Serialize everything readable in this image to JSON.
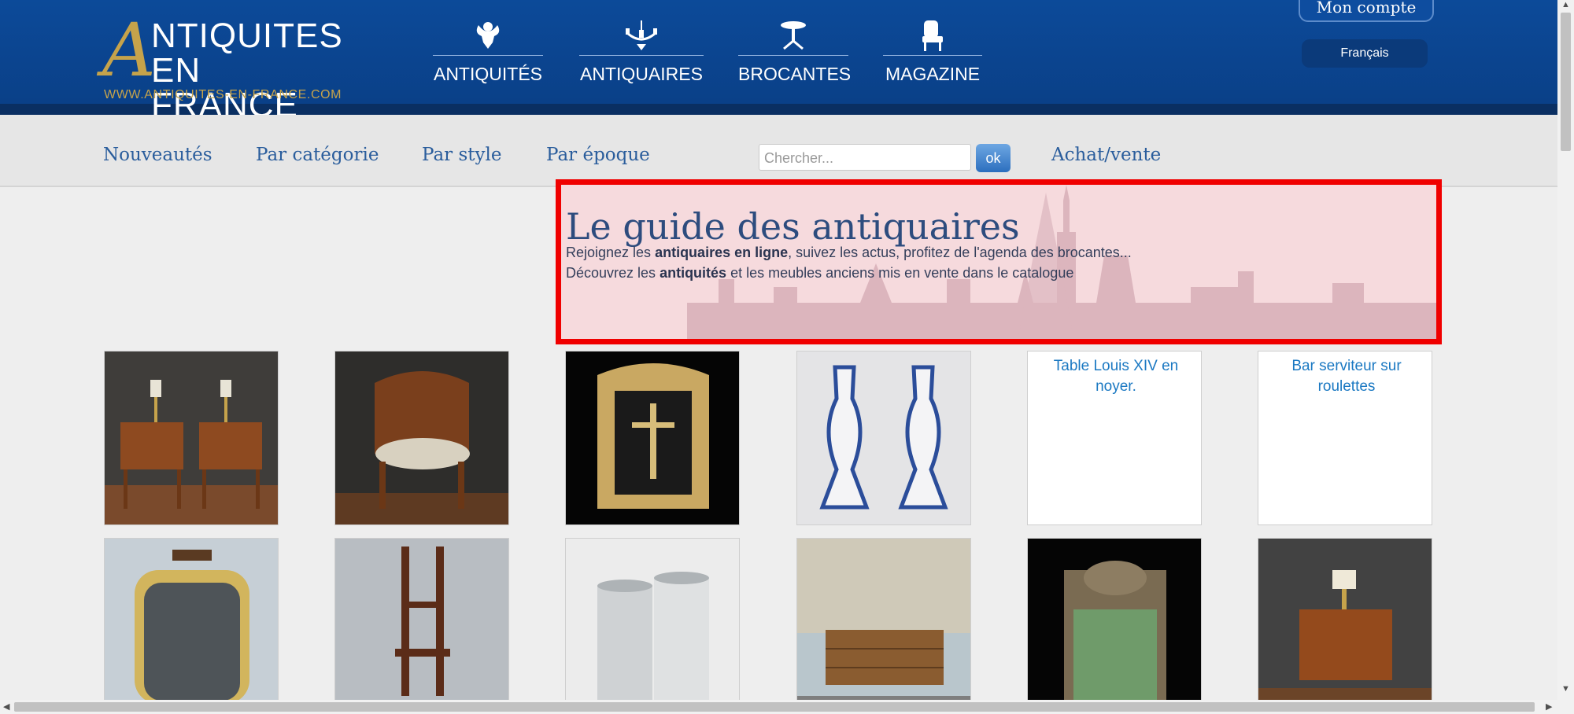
{
  "header": {
    "logo_first_letter": "A",
    "logo_line1": "NTIQUITES",
    "logo_line2": "EN FRANCE",
    "logo_url": "WWW.ANTIQUITES-EN-FRANCE.COM",
    "nav": [
      {
        "label": "ANTIQUITÉS",
        "icon": "cherub-icon"
      },
      {
        "label": "ANTIQUAIRES",
        "icon": "chandelier-icon"
      },
      {
        "label": "BROCANTES",
        "icon": "table-icon"
      },
      {
        "label": "MAGAZINE",
        "icon": "chair-icon"
      }
    ],
    "account_label": "Mon compte",
    "language": "Français"
  },
  "subnav": {
    "links": [
      "Nouveautés",
      "Par catégorie",
      "Par style",
      "Par époque"
    ],
    "search_placeholder": "Chercher...",
    "search_button": "ok",
    "achat_vente": "Achat/vente"
  },
  "intro": {
    "title": "Le guide des antiquaires",
    "line1_before": "Rejoignez les ",
    "line1_bold": "antiquaires en ligne",
    "line1_after": ", suivez les actus, profitez de l'agenda des brocantes...",
    "line2_before": "Découvrez les ",
    "line2_bold": "antiquités",
    "line2_after": " et les meubles anciens mis en vente dans le catalogue"
  },
  "grid": {
    "broken_alt_1": "Table Louis XIV en noyer.",
    "broken_alt_2": "Bar serviteur sur roulettes"
  },
  "colors": {
    "header_blue": "#0c4a99",
    "gold": "#c6a34b",
    "link_blue": "#2a5d9c",
    "highlight_border": "#f00000"
  }
}
